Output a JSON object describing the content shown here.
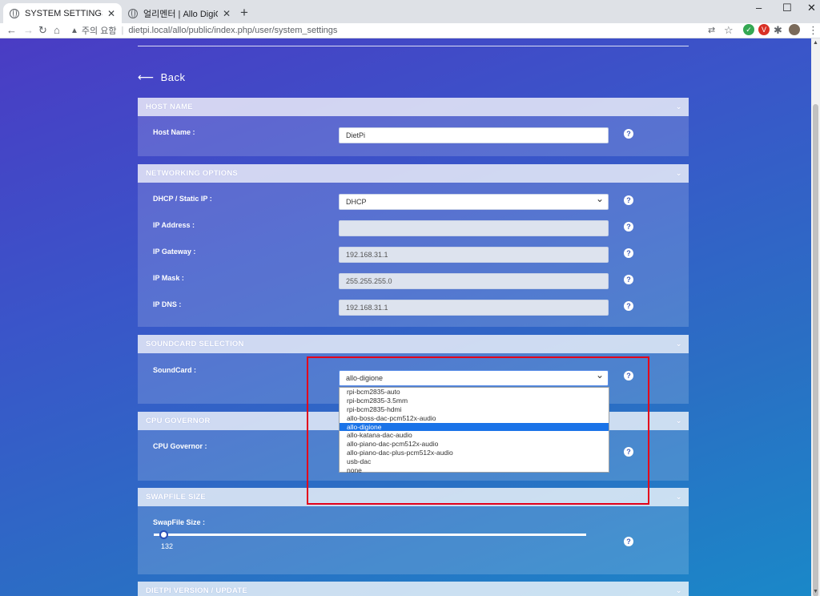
{
  "browser": {
    "tabs": [
      {
        "title": "SYSTEM SETTINGS",
        "active": true
      },
      {
        "title": "얼리멘터 | Allo DigiOne을 이용",
        "active": false
      }
    ],
    "security_label": "주의 요함",
    "url": "dietpi.local/allo/public/index.php/user/system_settings"
  },
  "page": {
    "back_label": "Back",
    "host_name": {
      "header": "HOST NAME",
      "label": "Host Name :",
      "value": "DietPi"
    },
    "networking": {
      "header": "NETWORKING OPTIONS",
      "dhcp_label": "DHCP / Static IP :",
      "dhcp_value": "DHCP",
      "ip_label": "IP Address :",
      "ip_value": "",
      "gateway_label": "IP Gateway :",
      "gateway_value": "192.168.31.1",
      "mask_label": "IP Mask :",
      "mask_value": "255.255.255.0",
      "dns_label": "IP DNS :",
      "dns_value": "192.168.31.1"
    },
    "soundcard": {
      "header": "SOUNDCARD SELECTION",
      "label": "SoundCard :",
      "selected": "allo-digione",
      "options": [
        "rpi-bcm2835-auto",
        "rpi-bcm2835-3.5mm",
        "rpi-bcm2835-hdmi",
        "allo-boss-dac-pcm512x-audio",
        "allo-digione",
        "allo-katana-dac-audio",
        "allo-piano-dac-pcm512x-audio",
        "allo-piano-dac-plus-pcm512x-audio",
        "usb-dac",
        "none"
      ]
    },
    "cpu": {
      "header": "CPU GOVERNOR",
      "label": "CPU Governor :"
    },
    "swapfile": {
      "header": "SWAPFILE SIZE",
      "label": "SwapFile Size :",
      "value": "132"
    },
    "version": {
      "header": "DIETPI VERSION / UPDATE"
    },
    "help_glyph": "?"
  },
  "colors": {
    "accent_selected": "#1a73e8",
    "highlight_box": "#e3001b"
  }
}
